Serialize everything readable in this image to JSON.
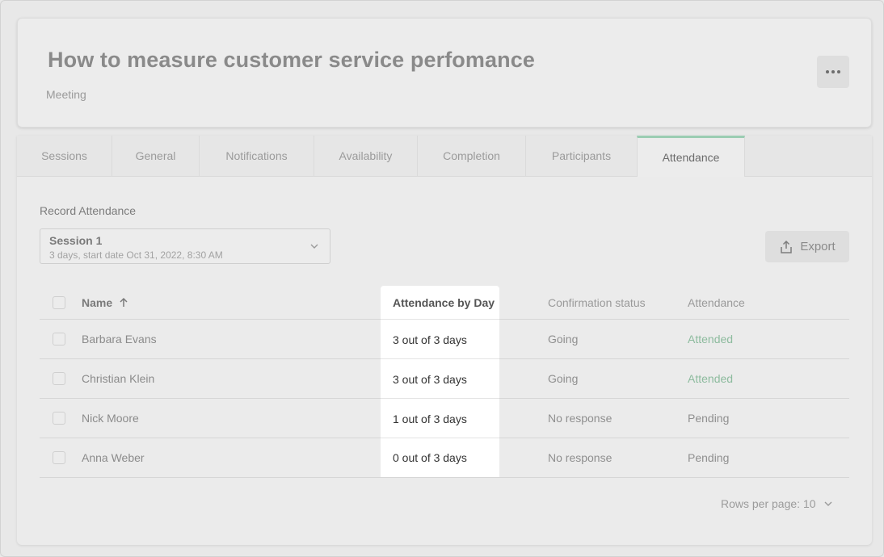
{
  "header": {
    "title": "How to measure customer service perfomance",
    "subtitle": "Meeting"
  },
  "tabs": [
    {
      "label": "Sessions"
    },
    {
      "label": "General"
    },
    {
      "label": "Notifications"
    },
    {
      "label": "Availability"
    },
    {
      "label": "Completion"
    },
    {
      "label": "Participants"
    },
    {
      "label": "Attendance",
      "active": true
    }
  ],
  "record": {
    "label": "Record Attendance",
    "session_name": "Session 1",
    "session_detail": "3 days, start date Oct 31, 2022, 8:30 AM"
  },
  "export_label": "Export",
  "table": {
    "headers": {
      "name": "Name",
      "days": "Attendance by Day",
      "confirmation": "Confirmation status",
      "attendance": "Attendance"
    },
    "rows": [
      {
        "name": "Barbara Evans",
        "days": "3 out of 3 days",
        "confirmation": "Going",
        "attendance": "Attended"
      },
      {
        "name": "Christian Klein",
        "days": "3 out of 3 days",
        "confirmation": "Going",
        "attendance": "Attended"
      },
      {
        "name": "Nick Moore",
        "days": "1 out of 3 days",
        "confirmation": "No response",
        "attendance": "Pending"
      },
      {
        "name": "Anna Weber",
        "days": "0 out of 3 days",
        "confirmation": "No response",
        "attendance": "Pending"
      }
    ]
  },
  "pagination": {
    "rows_per_page": "Rows per page: 10"
  },
  "colors": {
    "accent": "#9bcdb2",
    "attended": "#8dbb9e"
  },
  "icons": {
    "more": "more-dots-icon",
    "sort": "arrow-up-icon",
    "export": "share-upload-icon",
    "dropdown": "chevron-down-icon"
  }
}
